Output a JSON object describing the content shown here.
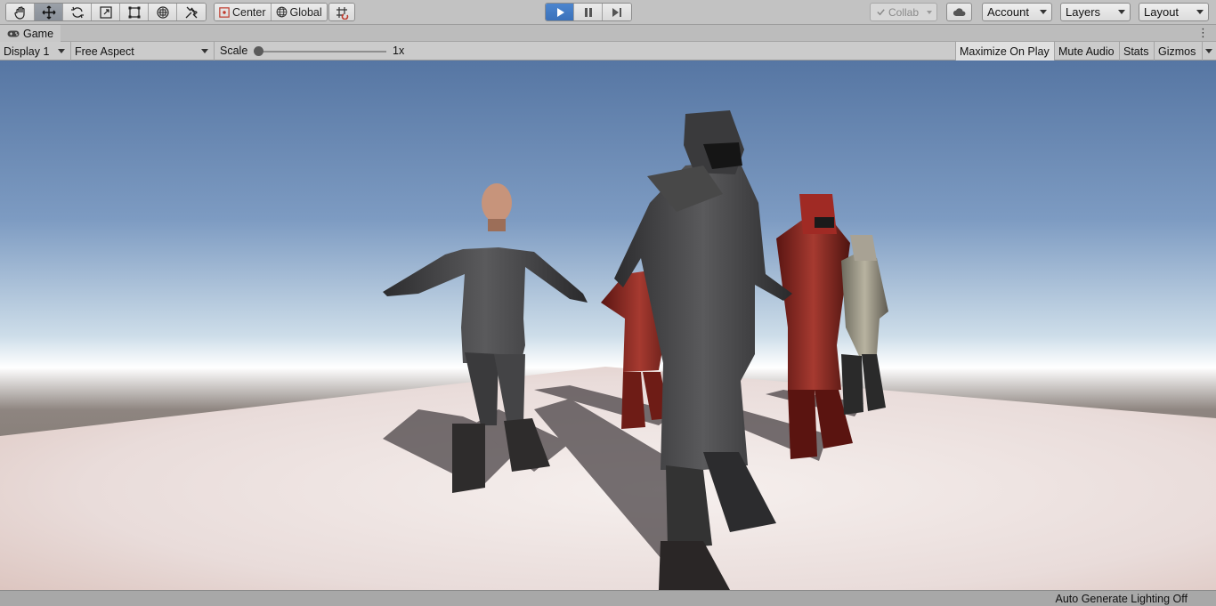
{
  "toolbar": {
    "transform_tools": [
      "hand-tool",
      "move-tool",
      "rotate-tool",
      "scale-tool",
      "rect-tool",
      "transform-tool",
      "custom-editor-tool"
    ],
    "active_tool": "move-tool",
    "pivot_mode": "Center",
    "pivot_rotation": "Global",
    "snap_icon": "grid-snap-icon",
    "play": {
      "state": "playing",
      "accent": "#3d74be"
    },
    "collab_label": "Collab",
    "account_label": "Account",
    "layers_label": "Layers",
    "layout_label": "Layout"
  },
  "tab": {
    "title": "Game",
    "icon": "gamepad-icon"
  },
  "game_controls": {
    "display": "Display 1",
    "aspect": "Free Aspect",
    "scale_label": "Scale",
    "scale_value": "1x",
    "maximize_on_play": "Maximize On Play",
    "mute_audio": "Mute Audio",
    "stats": "Stats",
    "gizmos": "Gizmos"
  },
  "viewport": {
    "sky_top": "#5676a3",
    "sky_horizon": "#ffffff",
    "ground_far": "#716861",
    "floor_color": "#ece3e0"
  },
  "status": {
    "text": "Auto Generate Lighting Off"
  }
}
